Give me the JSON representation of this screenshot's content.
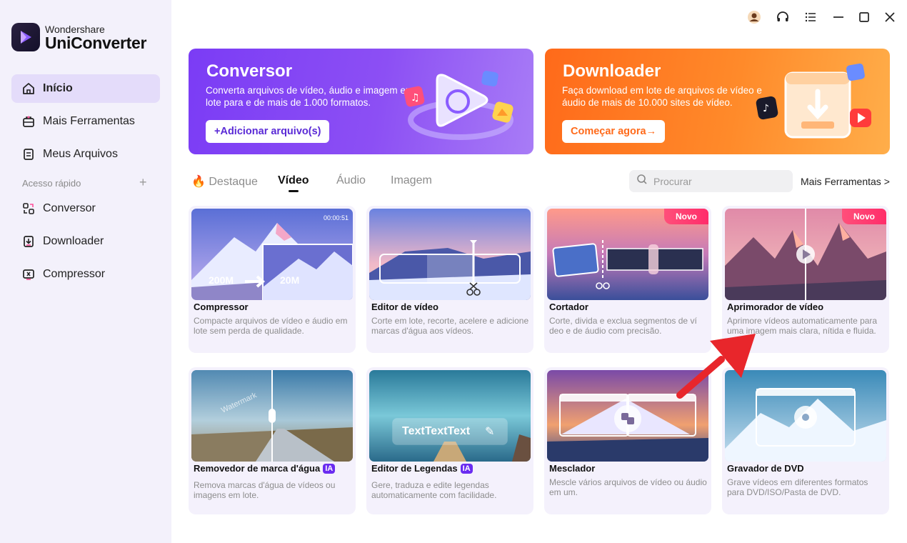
{
  "brand": {
    "small": "Wondershare",
    "big": "UniConverter"
  },
  "sidebar": {
    "items": [
      {
        "label": "Início",
        "icon": "home-icon"
      },
      {
        "label": "Mais Ferramentas",
        "icon": "toolbox-icon"
      },
      {
        "label": "Meus Arquivos",
        "icon": "files-icon"
      }
    ],
    "quick_access_label": "Acesso rápido",
    "quick_items": [
      {
        "label": "Conversor",
        "icon": "converter-icon"
      },
      {
        "label": "Downloader",
        "icon": "downloader-icon"
      },
      {
        "label": "Compressor",
        "icon": "compressor-icon"
      }
    ]
  },
  "banners": {
    "converter": {
      "title": "Conversor",
      "desc": "Converta arquivos de vídeo, áudio e imagem em lote para e de mais de 1.000 formatos.",
      "button": "+Adicionar arquivo(s)",
      "color": "#7b3cf5"
    },
    "downloader": {
      "title": "Downloader",
      "desc": "Faça download em lote de arquivos de vídeo e áudio de mais de 10.000 sites de vídeo.",
      "button": "Começar agora→",
      "color": "#ff7a22"
    }
  },
  "tabs": [
    "Destaque",
    "Vídeo",
    "Áudio",
    "Imagem"
  ],
  "active_tab": "Vídeo",
  "search": {
    "placeholder": "Procurar"
  },
  "more_tools": "Mais Ferramentas >",
  "cards": [
    {
      "title": "Compressor",
      "desc": "Compacte arquivos de vídeo e áudio em lote sem perda de qualidade.",
      "timestamp": "00:00:51",
      "size_from": "200M",
      "size_to": "20M"
    },
    {
      "title": "Editor de vídeo",
      "desc": "Corte em lote, recorte, acelere e adicione marcas d'água aos vídeos."
    },
    {
      "title": "Cortador",
      "desc": "Corte, divida e exclua segmentos de ví deo e de áudio com precisão.",
      "badge": "Novo"
    },
    {
      "title": "Aprimorador de vídeo",
      "desc": "Aprimore vídeos automaticamente para uma imagem mais clara, nítida e fluida.",
      "badge": "Novo"
    },
    {
      "title": "Removedor de marca d'água",
      "ia": "IA",
      "desc": "Remova marcas d'água de vídeos ou imagens em lote.",
      "watermark_text": "Watermark"
    },
    {
      "title": "Editor de Legendas",
      "ia": "IA",
      "desc": "Gere, traduza e edite legendas automaticamente com facilidade.",
      "overlay_text": "TextTextText"
    },
    {
      "title": "Mesclador",
      "desc": "Mescle vários arquivos de vídeo ou áudio em um."
    },
    {
      "title": "Gravador de DVD",
      "desc": "Grave vídeos em diferentes formatos para DVD/ISO/Pasta de DVD."
    }
  ],
  "colors": {
    "accent": "#7b3cf5",
    "sidebar_bg": "#f3f1fb",
    "active_nav": "#e4dcfa",
    "badge_new": "#ff3d6e",
    "arrow": "#e8262b"
  }
}
